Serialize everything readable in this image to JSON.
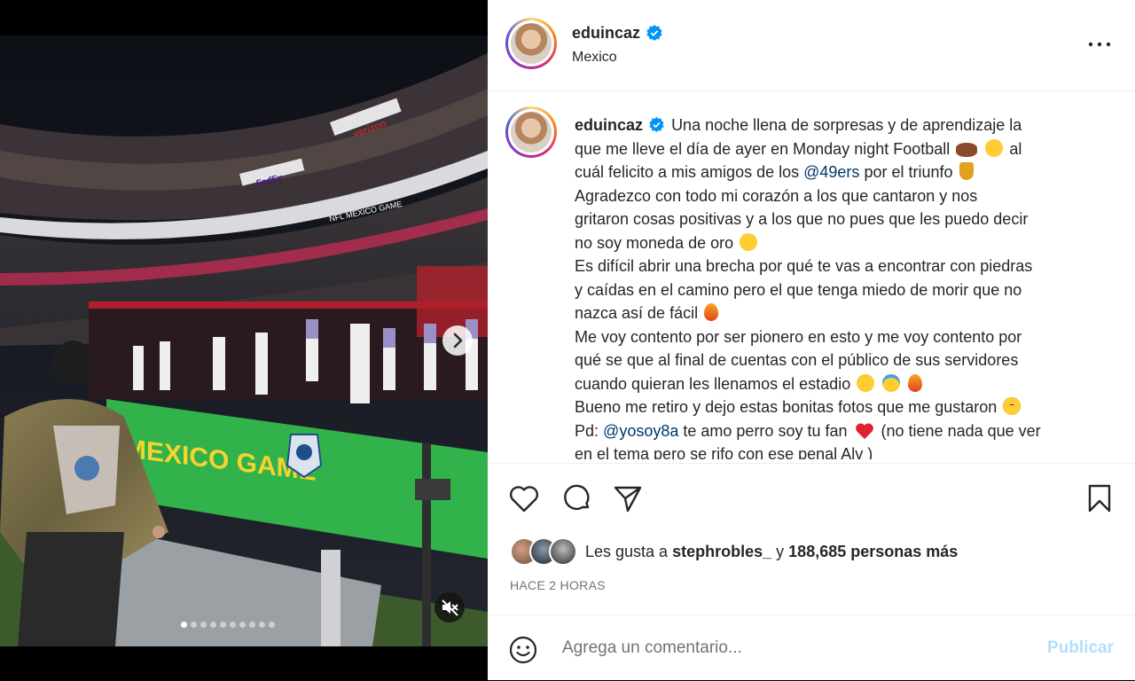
{
  "post": {
    "username": "eduincaz",
    "location": "Mexico"
  },
  "caption": {
    "username": "eduincaz",
    "lines": [
      {
        "before": "Una noche llena de sorpresas y de aprendizaje la",
        "after": ""
      },
      {
        "before": "que me lleve el día de ayer en Monday night Football",
        "after": "al"
      },
      {
        "before": "cuál felicito a mis amigos de los",
        "mention": "@49ers",
        "after": "por el triunfo"
      },
      {
        "before": "Agradezco con todo mi corazón a los que cantaron y nos",
        "after": ""
      },
      {
        "before": "gritaron cosas positivas y a los que no pues que les puedo decir",
        "after": ""
      },
      {
        "before": "no soy moneda de oro",
        "after": ""
      },
      {
        "before": "Es difícil abrir una brecha por qué te vas a encontrar con piedras",
        "after": ""
      },
      {
        "before": "y caídas en el camino pero el que tenga miedo de morir que no",
        "after": ""
      },
      {
        "before": "nazca así de fácil",
        "after": ""
      },
      {
        "before": "Me voy contento por ser pionero en esto y me voy contento por",
        "after": ""
      },
      {
        "before": "qué se que al final de cuentas con el público de sus servidores",
        "after": ""
      },
      {
        "before": "cuando quieran les llenamos el estadio",
        "after": ""
      },
      {
        "before": "Bueno me retiro y dejo estas bonitas fotos que me gustaron",
        "after": ""
      },
      {
        "before": "Pd:",
        "mention": "@yosoy8a",
        "after": "te amo perro soy tu fan"
      },
      {
        "before": "en el tema pero se rifo con ese penal Alv )",
        "after": ""
      }
    ],
    "pd_tail": "(no tiene nada que ver"
  },
  "likes": {
    "prefix": "Les gusta a",
    "user": "stephrobles_",
    "connector": "y",
    "count": "188,685 personas más"
  },
  "timestamp": "HACE 2 HORAS",
  "comment": {
    "placeholder": "Agrega un comentario...",
    "post_label": "Publicar"
  },
  "media": {
    "banner_text": "MEXICO GAME",
    "stadium_sign_1": "verizon",
    "stadium_sign_2": "FedEx",
    "stadium_sign_3": "NFL MEXICO GAME",
    "slide_count": 10,
    "active_slide": 1
  },
  "icons": {
    "verified": "verified-badge-icon",
    "more": "more-options-icon",
    "like": "heart-icon",
    "comment": "comment-icon",
    "share": "share-icon",
    "save": "bookmark-icon",
    "next": "chevron-right-icon",
    "mute": "muted-speaker-icon",
    "emoji": "smiley-icon"
  },
  "colors": {
    "verified": "#0095f6",
    "mention": "#00376b",
    "publish_disabled": "#b2dffc",
    "banner_green": "#32b24a",
    "banner_text": "#f5d330"
  }
}
